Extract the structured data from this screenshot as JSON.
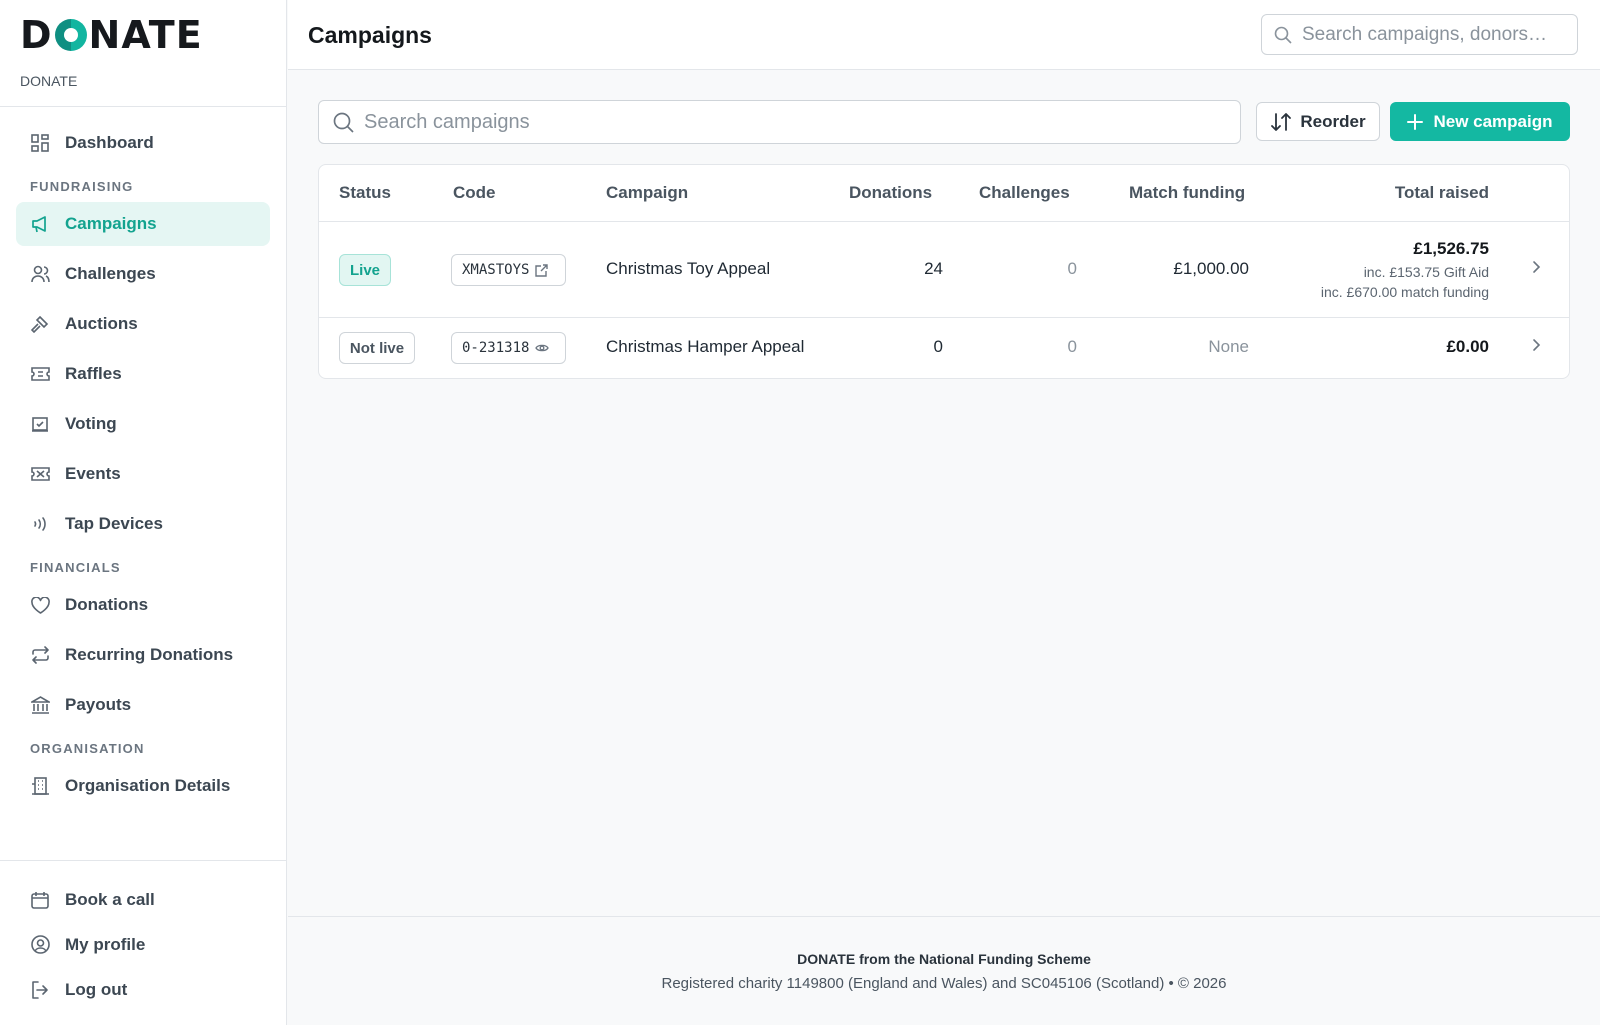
{
  "brand": {
    "logo_text": "DONATE",
    "subtitle": "DONATE"
  },
  "nav": {
    "dashboard": "Dashboard",
    "section_fundraising": "FUNDRAISING",
    "campaigns": "Campaigns",
    "challenges": "Challenges",
    "auctions": "Auctions",
    "raffles": "Raffles",
    "voting": "Voting",
    "events": "Events",
    "tap_devices": "Tap Devices",
    "section_financials": "FINANCIALS",
    "donations": "Donations",
    "recurring_donations": "Recurring Donations",
    "payouts": "Payouts",
    "section_organisation": "ORGANISATION",
    "organisation_details": "Organisation Details",
    "book_a_call": "Book a call",
    "my_profile": "My profile",
    "log_out": "Log out"
  },
  "header": {
    "title": "Campaigns",
    "search_placeholder": "Search campaigns, donors…"
  },
  "toolbar": {
    "search_placeholder": "Search campaigns",
    "reorder_label": "Reorder",
    "new_campaign_label": "New campaign"
  },
  "table": {
    "columns": [
      "Status",
      "Code",
      "Campaign",
      "Donations",
      "Challenges",
      "Match funding",
      "Total raised"
    ],
    "rows": [
      {
        "status": "Live",
        "code": "XMASTOYS",
        "code_icon": "external-link-icon",
        "campaign": "Christmas Toy Appeal",
        "donations": "24",
        "challenges": "0",
        "match_funding": "£1,000.00",
        "total_raised": "£1,526.75",
        "gift_aid_note": "inc. £153.75 Gift Aid",
        "match_note": "inc. £670.00 match funding"
      },
      {
        "status": "Not live",
        "code": "0-231318",
        "code_icon": "eye-icon",
        "campaign": "Christmas Hamper Appeal",
        "donations": "0",
        "challenges": "0",
        "match_funding": "None",
        "total_raised": "£0.00"
      }
    ]
  },
  "footer": {
    "line1": "DONATE from the National Funding Scheme",
    "line2": "Registered charity 1149800 (England and Wales) and SC045106 (Scotland)  •  © 2026"
  },
  "colors": {
    "accent": "#14b8a2",
    "accent_bg": "#e5f6f3"
  }
}
